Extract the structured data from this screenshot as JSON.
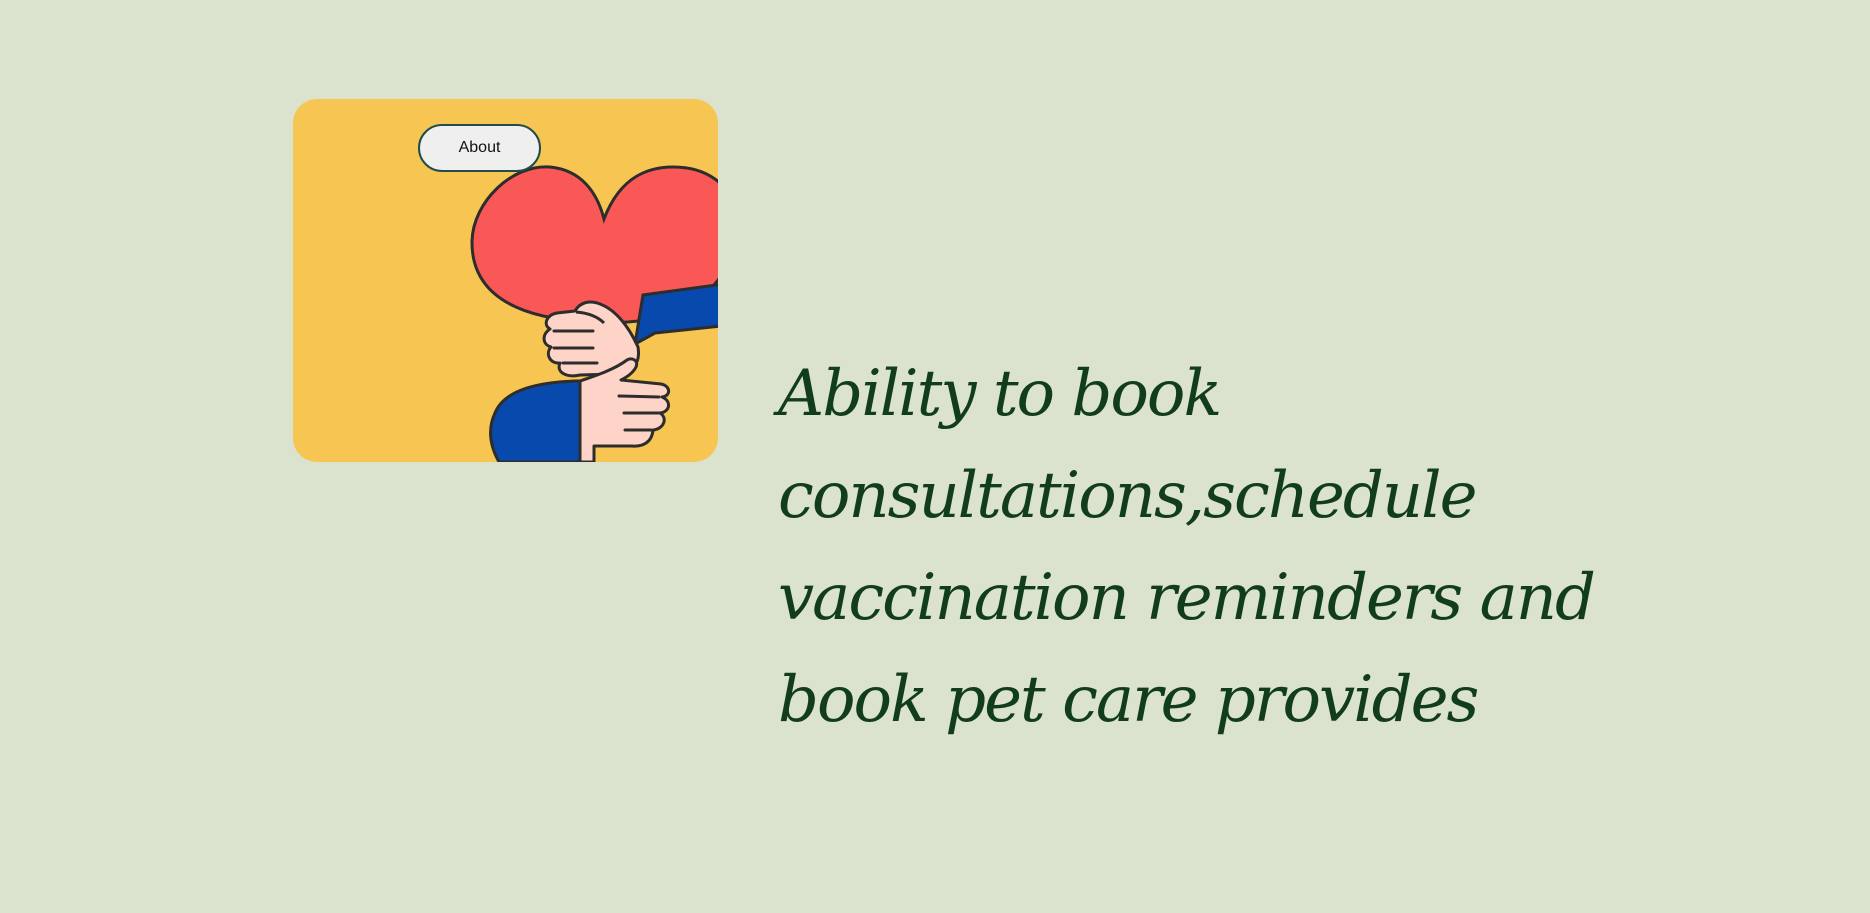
{
  "card": {
    "button": {
      "label": "About"
    },
    "illustration": {
      "name": "heart-hug-illustration",
      "colors": {
        "background": "#f7c552",
        "heart": "#f95856",
        "sleeve": "#0849ad",
        "hand": "#ffd4c8",
        "outline": "#2d2d2d"
      }
    }
  },
  "headline": {
    "text": "Ability to book consultations,schedule vaccination reminders and book pet care provides"
  },
  "colors": {
    "page_background": "#dbe3cf",
    "headline": "#123d1d",
    "card_background": "#f7c552"
  }
}
